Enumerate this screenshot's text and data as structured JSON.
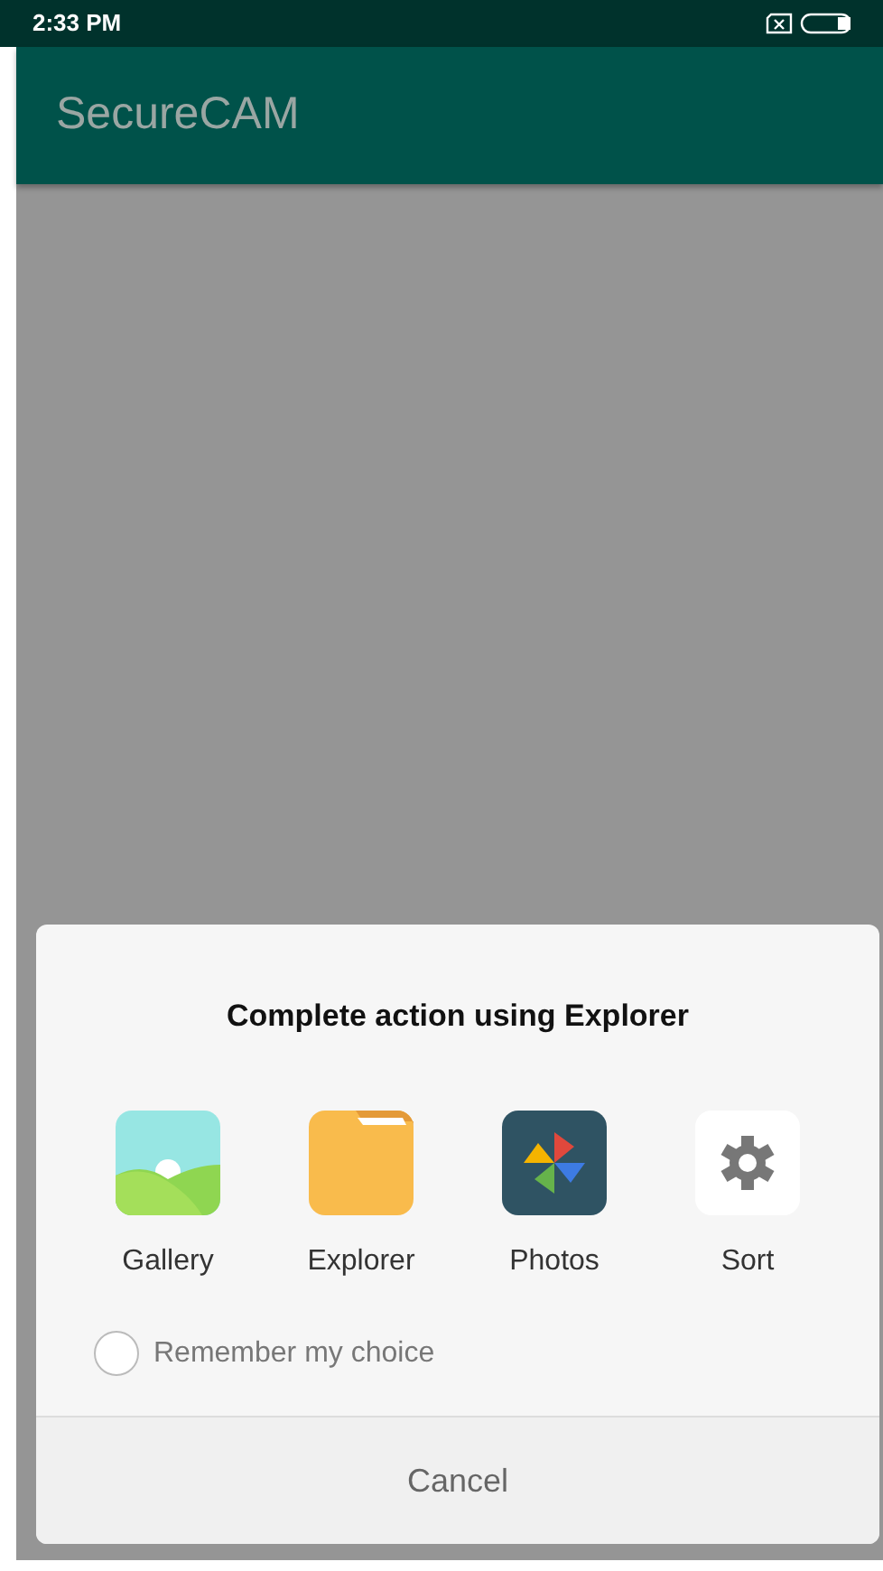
{
  "status_bar": {
    "time": "2:33 PM"
  },
  "app_bar": {
    "title": "SecureCAM"
  },
  "dialog": {
    "title": "Complete action using Explorer",
    "apps": [
      {
        "kind": "gallery",
        "label": "Gallery"
      },
      {
        "kind": "folder",
        "label": "Explorer"
      },
      {
        "kind": "pinwheel",
        "label": "Photos"
      },
      {
        "kind": "gear",
        "label": "Sort"
      }
    ],
    "remember": {
      "label": "Remember my choice",
      "checked": false
    },
    "cancel": "Cancel"
  }
}
